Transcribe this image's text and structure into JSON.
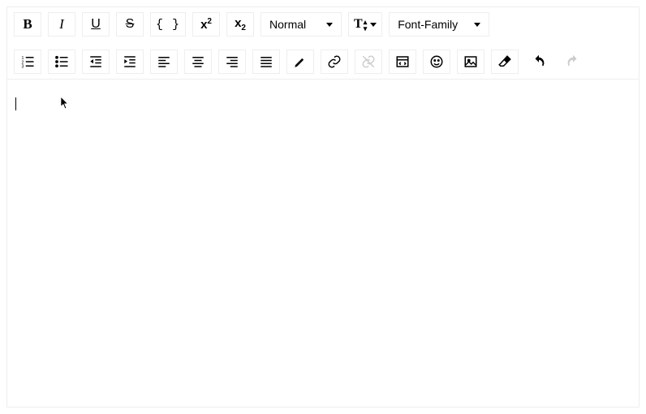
{
  "toolbar": {
    "bold_label": "B",
    "italic_label": "I",
    "underline_label": "U",
    "strike_label": "S",
    "code_label": "{ }",
    "superscript_label": "x",
    "superscript_exp": "2",
    "subscript_label": "x",
    "subscript_exp": "2",
    "heading_label": "Normal",
    "textsize_label": "T",
    "fontfamily_label": "Font-Family"
  },
  "editor": {
    "content": ""
  }
}
